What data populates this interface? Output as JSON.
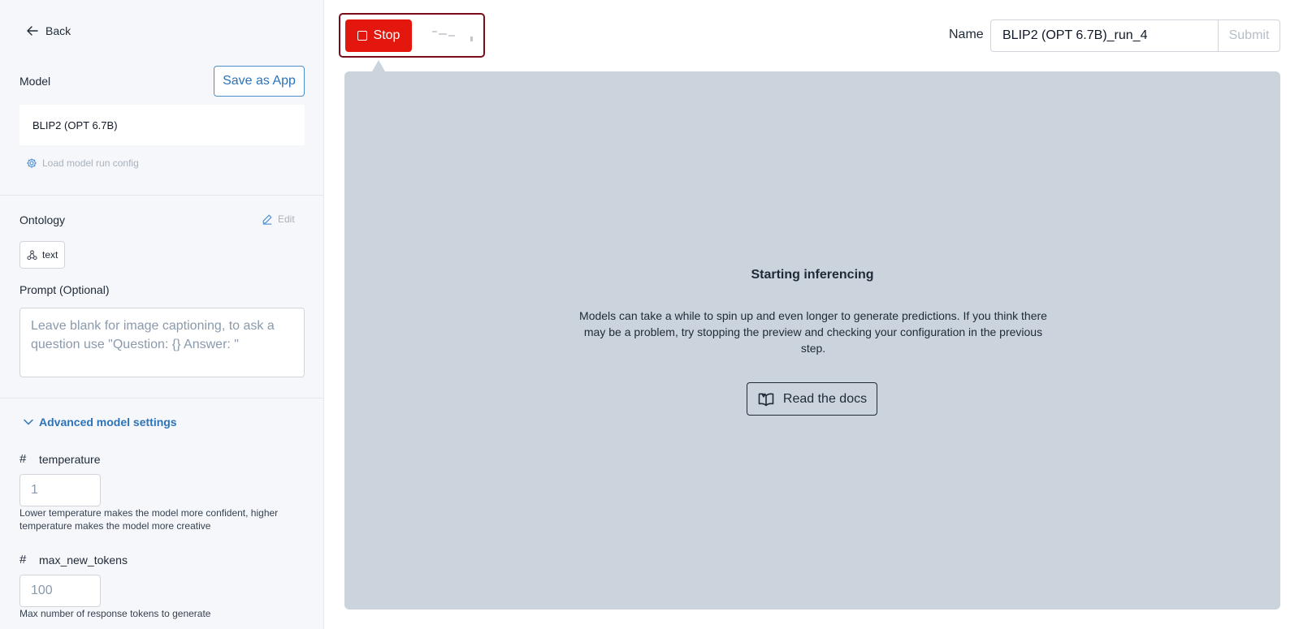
{
  "sidebar": {
    "back_label": "Back",
    "model": {
      "label": "Model",
      "save_as_app_label": "Save as App",
      "selected_model": "BLIP2 (OPT 6.7B)",
      "load_config_label": "Load model run config"
    },
    "ontology": {
      "label": "Ontology",
      "edit_label": "Edit",
      "chip_label": "text"
    },
    "prompt": {
      "label": "Prompt (Optional)",
      "placeholder": "Leave blank for image captioning, to ask a question use \"Question: {} Answer: \""
    },
    "advanced": {
      "toggle_label": "Advanced model settings",
      "params": [
        {
          "name": "temperature",
          "placeholder": "1",
          "help": "Lower temperature makes the model more confident, higher temperature makes the model more creative"
        },
        {
          "name": "max_new_tokens",
          "placeholder": "100",
          "help": "Max number of response tokens to generate"
        }
      ]
    }
  },
  "toolbar": {
    "stop_label": "Stop",
    "name_label": "Name",
    "name_value": "BLIP2 (OPT 6.7B)_run_4",
    "submit_label": "Submit"
  },
  "preview": {
    "title": "Starting inferencing",
    "description": "Models can take a while to spin up and even longer to generate predictions. If you think there may be a problem, try stopping the preview and checking your configuration in the previous step.",
    "docs_label": "Read the docs"
  },
  "colors": {
    "accent": "#2c73b9",
    "stop": "#e4170e",
    "highlight_frame": "#7a0d1a",
    "preview_bg": "#cbd3dd"
  }
}
